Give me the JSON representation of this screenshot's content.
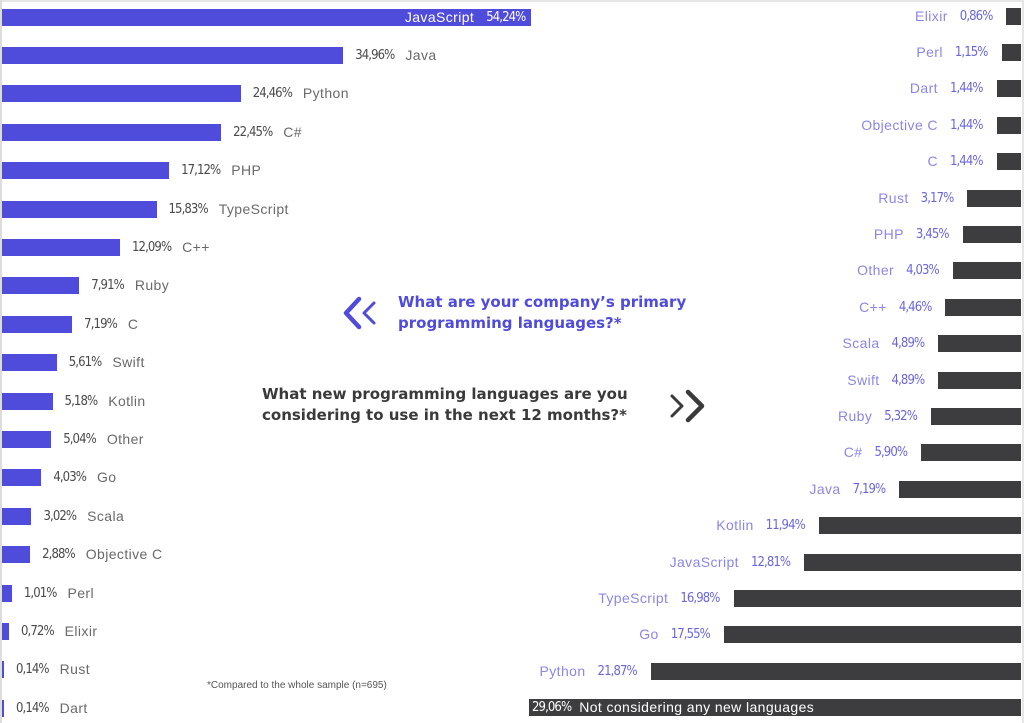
{
  "questions": {
    "primary": "What are your company’s primary programming languages?*",
    "new": "What new programming languages are you considering to use in the next 12 months?*"
  },
  "icons": {
    "left": "double-chevron-left-icon",
    "right": "double-chevron-right-icon"
  },
  "footnote": "*Compared to the whole sample (n=695)",
  "colors": {
    "primary_bar": "#4f4bdb",
    "new_bar": "#3d3d40",
    "new_label": "#8a87e6"
  },
  "chart_data": [
    {
      "type": "bar",
      "orientation": "horizontal",
      "title": "What are your company’s primary programming languages?*",
      "direction": "left-to-right",
      "categories": [
        "JavaScript",
        "Java",
        "Python",
        "C#",
        "PHP",
        "TypeScript",
        "C++",
        "Ruby",
        "C",
        "Swift",
        "Kotlin",
        "Other",
        "Go",
        "Scala",
        "Objective C",
        "Perl",
        "Elixir",
        "Rust",
        "Dart"
      ],
      "values": [
        54.24,
        34.96,
        24.46,
        22.45,
        17.12,
        15.83,
        12.09,
        7.91,
        7.19,
        5.61,
        5.18,
        5.04,
        4.03,
        3.02,
        2.88,
        1.01,
        0.72,
        0.14,
        0.14
      ],
      "value_labels": [
        "54,24%",
        "34,96%",
        "24,46%",
        "22,45%",
        "17,12%",
        "15,83%",
        "12,09%",
        "7,91%",
        "7,19%",
        "5,61%",
        "5,18%",
        "5,04%",
        "4,03%",
        "3,02%",
        "2,88%",
        "1,01%",
        "0,72%",
        "0,14%",
        "0,14%"
      ],
      "unit": "%",
      "color": "#4f4bdb",
      "xlabel": "",
      "ylabel": "",
      "xlim": [
        0,
        55
      ],
      "grid": false
    },
    {
      "type": "bar",
      "orientation": "horizontal",
      "title": "What new programming languages are you considering to use in the next 12 months?*",
      "direction": "right-to-left",
      "categories": [
        "Elixir",
        "Perl",
        "Dart",
        "Objective C",
        "C",
        "Rust",
        "PHP",
        "Other",
        "C++",
        "Scala",
        "Swift",
        "Ruby",
        "C#",
        "Java",
        "Kotlin",
        "JavaScript",
        "TypeScript",
        "Go",
        "Python",
        "Not considering any new languages"
      ],
      "values": [
        0.86,
        1.15,
        1.44,
        1.44,
        1.44,
        3.17,
        3.45,
        4.03,
        4.46,
        4.89,
        4.89,
        5.32,
        5.9,
        7.19,
        11.94,
        12.81,
        16.98,
        17.55,
        21.87,
        29.06
      ],
      "value_labels": [
        "0,86%",
        "1,15%",
        "1,44%",
        "1,44%",
        "1,44%",
        "3,17%",
        "3,45%",
        "4,03%",
        "4,46%",
        "4,89%",
        "4,89%",
        "5,32%",
        "5,90%",
        "7,19%",
        "11,94%",
        "12,81%",
        "16,98%",
        "17,55%",
        "21,87%",
        "29,06%"
      ],
      "unit": "%",
      "color": "#3d3d40",
      "xlabel": "",
      "ylabel": "",
      "xlim": [
        0,
        29.06
      ],
      "grid": false
    }
  ]
}
